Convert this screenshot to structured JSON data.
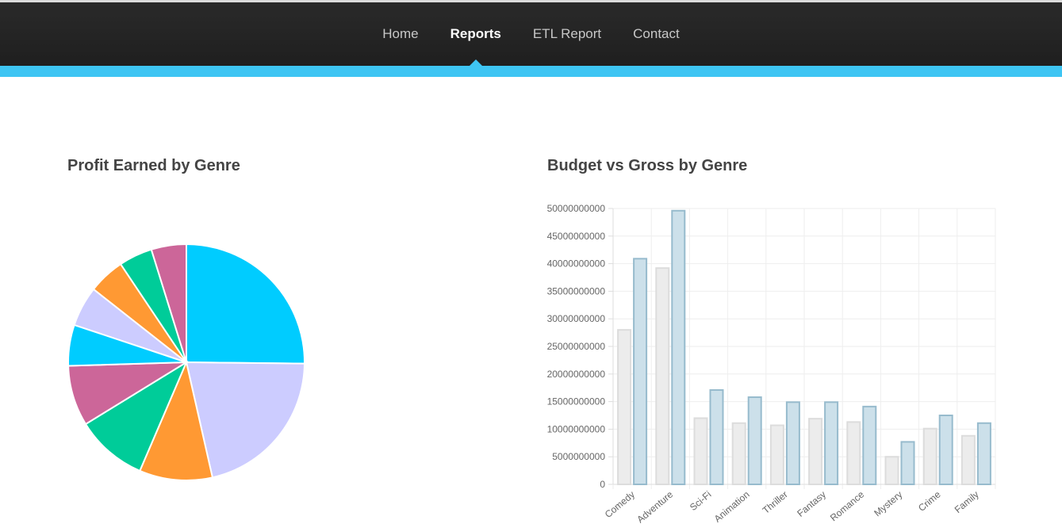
{
  "nav": {
    "items": [
      {
        "label": "Home",
        "active": false
      },
      {
        "label": "Reports",
        "active": true
      },
      {
        "label": "ETL Report",
        "active": false
      },
      {
        "label": "Contact",
        "active": false
      }
    ]
  },
  "colors": {
    "navbar": "#222222",
    "accent": "#3ec5f3",
    "pie_slices": [
      "#00ccff",
      "#ccccff",
      "#ff9933",
      "#00cc99",
      "#cc6699",
      "#00ccff",
      "#ccccff",
      "#ff9933",
      "#00cc99",
      "#cc6699"
    ],
    "bar_budget_fill": "#ececec",
    "bar_budget_stroke": "#dcdcdc",
    "bar_gross_fill": "#cce0ea",
    "bar_gross_stroke": "#97bbcd"
  },
  "charts": {
    "pie_title": "Profit Earned by Genre",
    "bar_title": "Budget vs Gross by Genre"
  },
  "chart_data": [
    {
      "type": "pie",
      "title": "Profit Earned by Genre",
      "values": [
        25.2,
        21.3,
        10.0,
        9.8,
        8.3,
        5.6,
        5.5,
        5.0,
        4.6,
        4.8
      ]
    },
    {
      "type": "bar",
      "title": "Budget vs Gross by Genre",
      "categories": [
        "Comedy",
        "Adventure",
        "Sci-Fi",
        "Animation",
        "Thriller",
        "Fantasy",
        "Romance",
        "Mystery",
        "Crime",
        "Family"
      ],
      "series": [
        {
          "values": [
            28000000000,
            39200000000,
            12000000000,
            11100000000,
            10700000000,
            11900000000,
            11300000000,
            5000000000,
            10100000000,
            8800000000
          ]
        },
        {
          "values": [
            40900000000,
            49600000000,
            17100000000,
            15800000000,
            14900000000,
            14900000000,
            14100000000,
            7700000000,
            12500000000,
            11100000000
          ]
        }
      ],
      "yticks": [
        "0",
        "5000000000",
        "10000000000",
        "15000000000",
        "20000000000",
        "25000000000",
        "30000000000",
        "35000000000",
        "40000000000",
        "45000000000",
        "50000000000"
      ],
      "ylim": [
        0,
        50000000000
      ],
      "grid": true
    }
  ]
}
